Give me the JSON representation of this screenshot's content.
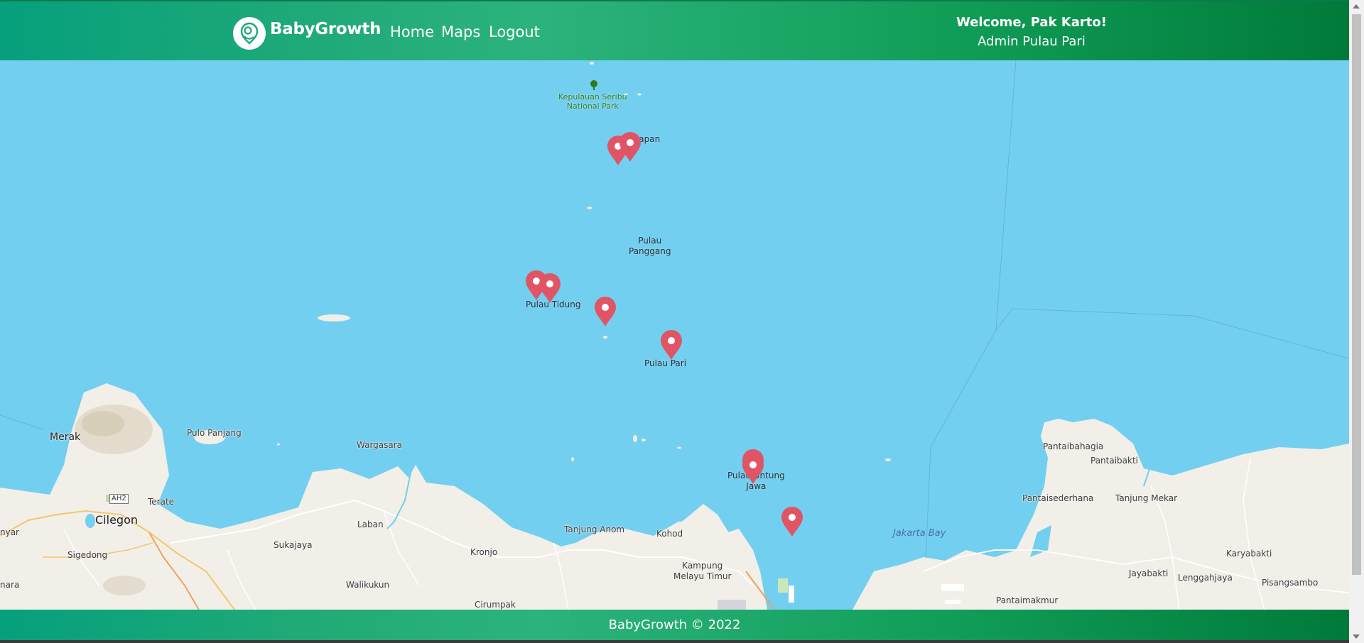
{
  "navbar": {
    "brand": "BabyGrowth",
    "links": [
      "Home",
      "Maps",
      "Logout"
    ],
    "welcome_title": "Welcome, Pak Karto!",
    "welcome_subtitle": "Admin Pulau Pari"
  },
  "map": {
    "labels": {
      "park_line1": "Kepulauan Seribu",
      "park_line2": "National Park",
      "harapan": "Harapan",
      "panggang_line1": "Pulau",
      "panggang_line2": "Panggang",
      "tidung": "Pulau Tidung",
      "pari": "Pulau Pari",
      "untung_line1": "Pulau Untung",
      "untung_line2": "Jawa",
      "merak": "Merak",
      "pulo_panjang": "Pulo Panjang",
      "wargasara": "Wargasara",
      "ah2": "AH2",
      "terate": "Terate",
      "cilegon": "Cilegon",
      "anyar": "nyar",
      "sigedong": "Sigedong",
      "nara": "nara",
      "sukajaya": "Sukajaya",
      "laban": "Laban",
      "kronjo": "Kronjo",
      "tanjung_anom": "Tanjung Anom",
      "kohod": "Kohod",
      "kampung_line1": "Kampung",
      "kampung_line2": "Melayu Timur",
      "walikukun": "Walikukun",
      "cirumpak": "Cirumpak",
      "jakarta_bay": "Jakarta Bay",
      "pantaibahagia": "Pantaibahagia",
      "pantaibakti": "Pantaibakti",
      "pantaisederhana": "Pantaisederhana",
      "tanjung_mekar": "Tanjung Mekar",
      "karyabakti": "Karyabakti",
      "jayabakti": "Jayabakti",
      "lenggahjaya": "Lenggahjaya",
      "pisangsambo": "Pisangsambo",
      "pantaimakmur": "Pantaimakmur"
    },
    "marker_count": 9,
    "colors": {
      "sea": "#73cff0",
      "land": "#f2efe9",
      "marker": "#e05565",
      "park": "#3c7d1e"
    }
  },
  "footer": {
    "text": "BabyGrowth © 2022"
  }
}
